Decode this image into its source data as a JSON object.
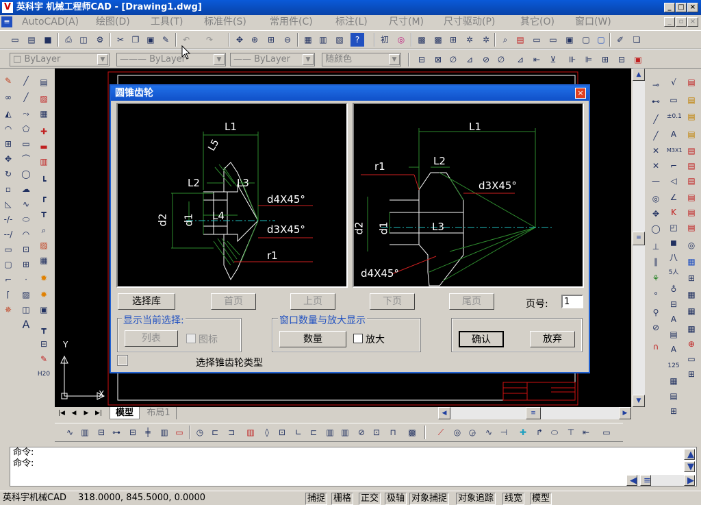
{
  "window": {
    "title": "英科宇 机械工程师CAD - [Drawing1.dwg]",
    "logo": "V"
  },
  "menus": [
    "AutoCAD(A)",
    "绘图(D)",
    "工具(T)",
    "标准件(S)",
    "常用件(C)",
    "标注(L)",
    "尺寸(M)",
    "尺寸驱动(P)",
    "其它(O)",
    "窗口(W)"
  ],
  "props": {
    "layer": "ByLayer",
    "linetype": "ByLayer",
    "lineweight": "ByLayer",
    "color": "随颜色"
  },
  "canvas": {
    "ucs_x": "X",
    "ucs_y": "Y"
  },
  "tabs": {
    "model": "模型",
    "layout": "布局1"
  },
  "command": {
    "line1": "命令:",
    "line2": "命令:"
  },
  "status": {
    "app": "英科宇机械CAD",
    "coords": "318.0000,  845.5000,  0.0000",
    "toggles": [
      "捕捉",
      "栅格",
      "正交",
      "极轴",
      "对象捕捉",
      "对象追踪",
      "线宽",
      "模型"
    ]
  },
  "dialog": {
    "title": "圆锥齿轮",
    "close": "×",
    "left_labels": {
      "L1": "L1",
      "L5": "L5",
      "L2": "L2",
      "L3": "L3",
      "d4": "d4X45°",
      "d2": "d2",
      "d1": "d1",
      "L4": "L4",
      "d3": "d3X45°",
      "r1": "r1"
    },
    "right_labels": {
      "L1": "L1",
      "r1": "r1",
      "L2": "L2",
      "d3": "d3X45°",
      "d2": "d2",
      "d1": "d1",
      "L3": "L3",
      "d4": "d4X45°"
    },
    "select_lib": "选择库",
    "first": "首页",
    "prev": "上页",
    "next": "下页",
    "last": "尾页",
    "page_label": "页号:",
    "page_value": "1",
    "group1": {
      "title": "显示当前选择:",
      "list": "列表",
      "icon": "图标"
    },
    "group2": {
      "title": "窗口数量与放大显示",
      "count": "数量",
      "zoom": "放大"
    },
    "ok": "确认",
    "cancel": "放弃",
    "type_label": "选择锥齿轮类型"
  }
}
